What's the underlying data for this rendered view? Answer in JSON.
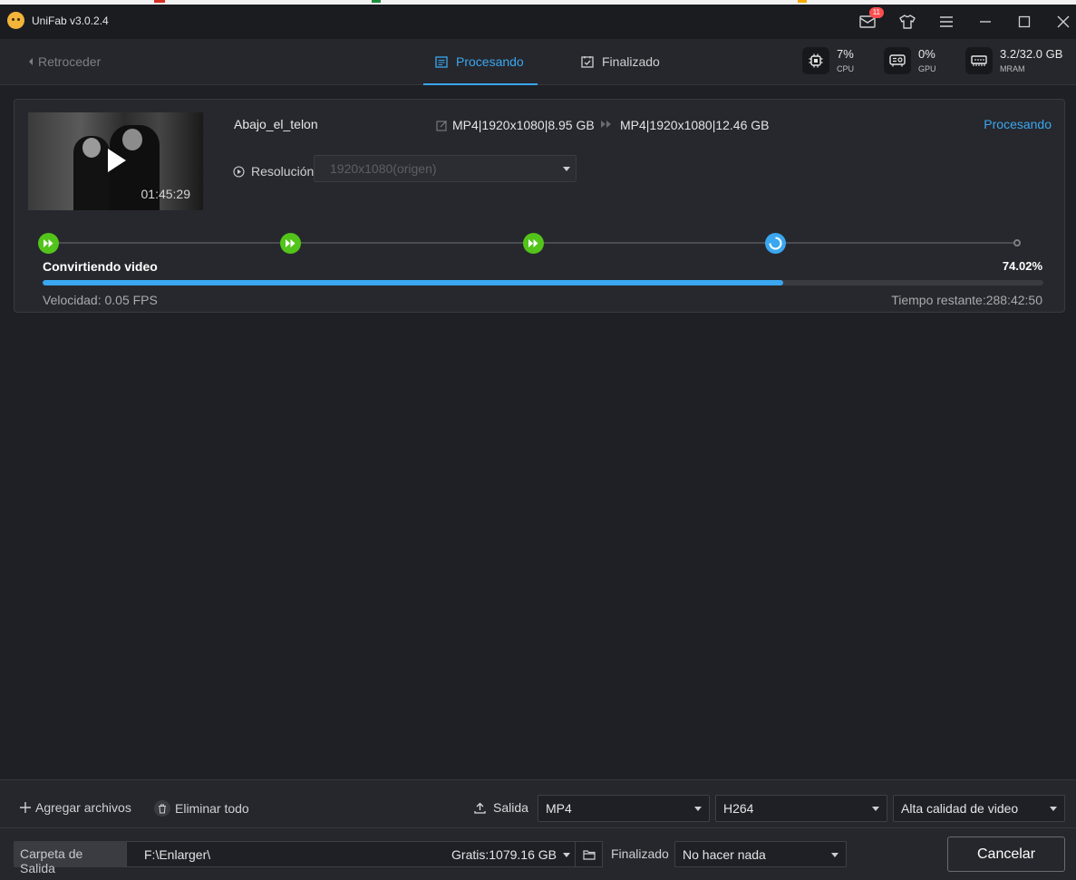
{
  "app": {
    "title": "UniFab v3.0.2.4",
    "notifications": "11"
  },
  "toolbar": {
    "back_label": "Retroceder",
    "tabs": [
      {
        "label": "Procesando",
        "active": true
      },
      {
        "label": "Finalizado",
        "active": false
      }
    ],
    "stats": {
      "cpu": {
        "value": "7%",
        "label": "CPU"
      },
      "gpu": {
        "value": "0%",
        "label": "GPU"
      },
      "mram": {
        "value": "3.2/32.0 GB",
        "label": "MRAM"
      }
    }
  },
  "task": {
    "filename": "Abajo_el_telon",
    "duration": "01:45:29",
    "input_format": "MP4|1920x1080|8.95 GB",
    "output_format": "MP4|1920x1080|12.46 GB",
    "status": "Procesando",
    "resolution_label": "Resolución",
    "resolution_value": "1920x1080(origen)",
    "step_label": "Convirtiendo video",
    "progress": 0.7402,
    "progress_text": "74.02%",
    "speed": "Velocidad: 0.05  FPS",
    "remaining": "Tiempo restante:288:42:50"
  },
  "bottom": {
    "add_files": "Agregar archivos",
    "delete_all": "Eliminar todo",
    "output_label": "Salida",
    "container": "MP4",
    "codec": "H264",
    "quality": "Alta calidad de video",
    "folder_label": "Carpeta de Salida",
    "folder_path": "F:\\Enlarger\\",
    "free_space": "Gratis:1079.16 GB",
    "finish_label": "Finalizado",
    "finish_action": "No hacer nada",
    "cancel": "Cancelar"
  },
  "colors": {
    "accent": "#3aa7f0",
    "success": "#52c41a",
    "badge": "#ff4d4f"
  }
}
